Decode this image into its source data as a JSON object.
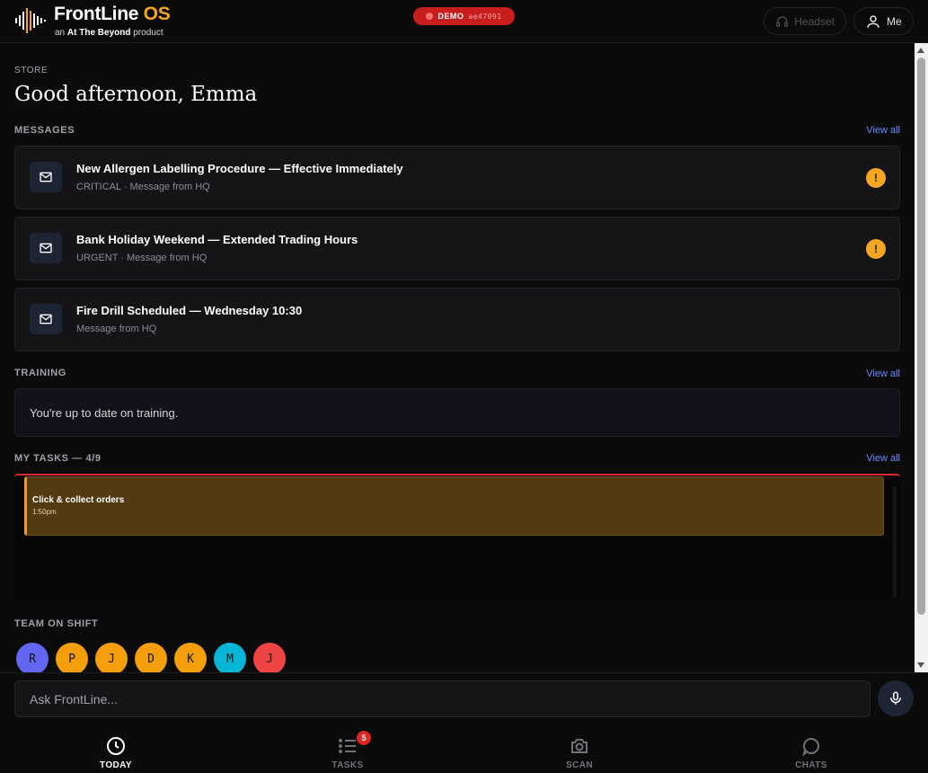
{
  "header": {
    "brand_main": "FrontLine",
    "brand_accent": "OS",
    "tagline_prefix": "an",
    "tagline_company": "At The Beyond",
    "tagline_suffix": "product",
    "demo_label": "DEMO",
    "demo_code": "ae47091",
    "headset_label": "Headset",
    "me_label": "Me"
  },
  "page": {
    "section": "STORE",
    "greeting": "Good afternoon, Emma"
  },
  "messages": {
    "label": "MESSAGES",
    "view_all": "View all",
    "items": [
      {
        "title": "New Allergen Labelling Procedure — Effective Immediately",
        "subtitle": "CRITICAL · Message from HQ",
        "alert": "!"
      },
      {
        "title": "Bank Holiday Weekend — Extended Trading Hours",
        "subtitle": "URGENT · Message from HQ",
        "alert": "!"
      },
      {
        "title": "Fire Drill Scheduled — Wednesday 10:30",
        "subtitle": "Message from HQ"
      }
    ]
  },
  "training": {
    "label": "TRAINING",
    "view_all": "View all",
    "status": "You're up to date on training."
  },
  "tasks": {
    "label": "MY TASKS — 4/9",
    "view_all": "View all",
    "items": [
      {
        "title": "Click & collect orders",
        "time": "1:50pm"
      }
    ]
  },
  "team": {
    "label": "TEAM ON SHIFT",
    "members": [
      {
        "initial": "R",
        "color": "#6366f1"
      },
      {
        "initial": "P",
        "color": "#f59e0b"
      },
      {
        "initial": "J",
        "color": "#f59e0b"
      },
      {
        "initial": "D",
        "color": "#f59e0b"
      },
      {
        "initial": "K",
        "color": "#f59e0b"
      },
      {
        "initial": "M",
        "color": "#06b6d4"
      },
      {
        "initial": "J",
        "color": "#ef4444"
      }
    ]
  },
  "ask": {
    "placeholder": "Ask FrontLine..."
  },
  "nav": {
    "today": "TODAY",
    "tasks": "TASKS",
    "tasks_badge": "5",
    "scan": "SCAN",
    "chats": "CHATS"
  },
  "colors": {
    "accent": "#f5a524",
    "link": "#6b8cff",
    "demo": "#c81e1e",
    "task_bg": "#533b11"
  }
}
